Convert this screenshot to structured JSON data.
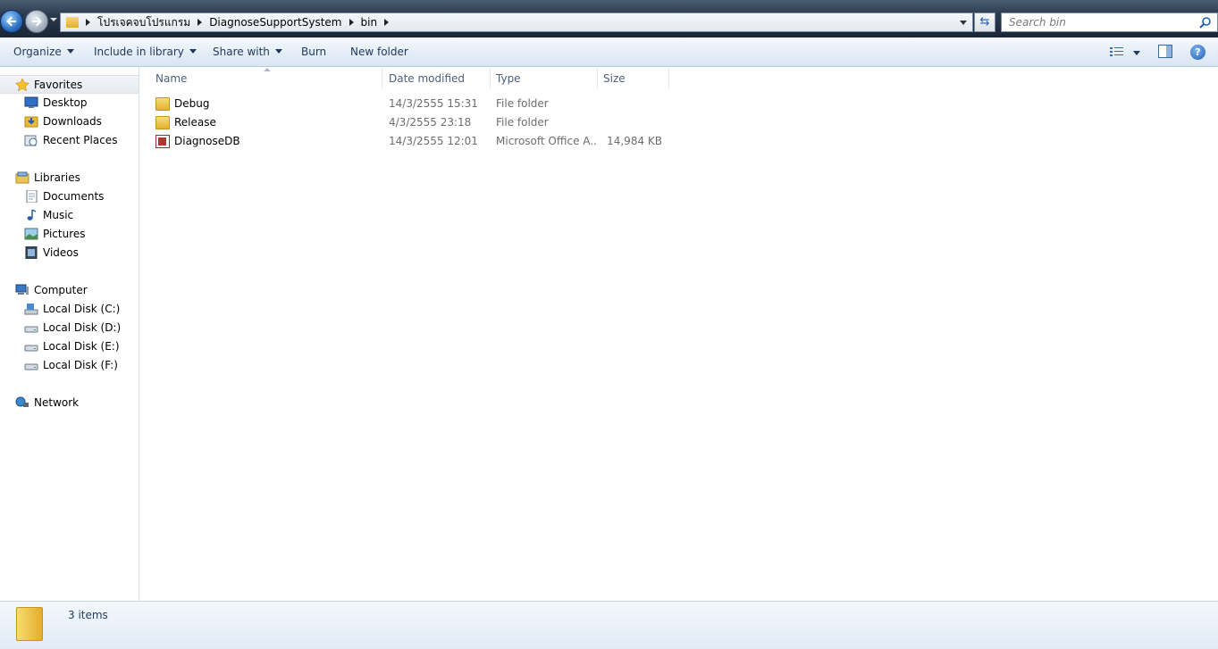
{
  "addressbar": {
    "breadcrumbs": [
      "โปรเจคจบโปรแกรม",
      "DiagnoseSupportSystem",
      "bin"
    ],
    "search_placeholder": "Search bin"
  },
  "toolbar": {
    "organize": "Organize",
    "include_in_library": "Include in library",
    "share_with": "Share with",
    "burn": "Burn",
    "new_folder": "New folder"
  },
  "navpane": {
    "favorites": "Favorites",
    "desktop": "Desktop",
    "downloads": "Downloads",
    "recent_places": "Recent Places",
    "libraries": "Libraries",
    "documents": "Documents",
    "music": "Music",
    "pictures": "Pictures",
    "videos": "Videos",
    "computer": "Computer",
    "disk_c": "Local Disk (C:)",
    "disk_d": "Local Disk (D:)",
    "disk_e": "Local Disk (E:)",
    "disk_f": "Local Disk (F:)",
    "network": "Network"
  },
  "columns": {
    "name": "Name",
    "date_modified": "Date modified",
    "type": "Type",
    "size": "Size"
  },
  "files": [
    {
      "name": "Debug",
      "date": "14/3/2555 15:31",
      "type": "File folder",
      "size": "",
      "icon": "folder-icon"
    },
    {
      "name": "Release",
      "date": "4/3/2555 23:18",
      "type": "File folder",
      "size": "",
      "icon": "folder-icon"
    },
    {
      "name": "DiagnoseDB",
      "date": "14/3/2555 12:01",
      "type": "Microsoft Office A...",
      "size": "14,984 KB",
      "icon": "access-database-icon"
    }
  ],
  "status": {
    "item_count": "3 items"
  }
}
